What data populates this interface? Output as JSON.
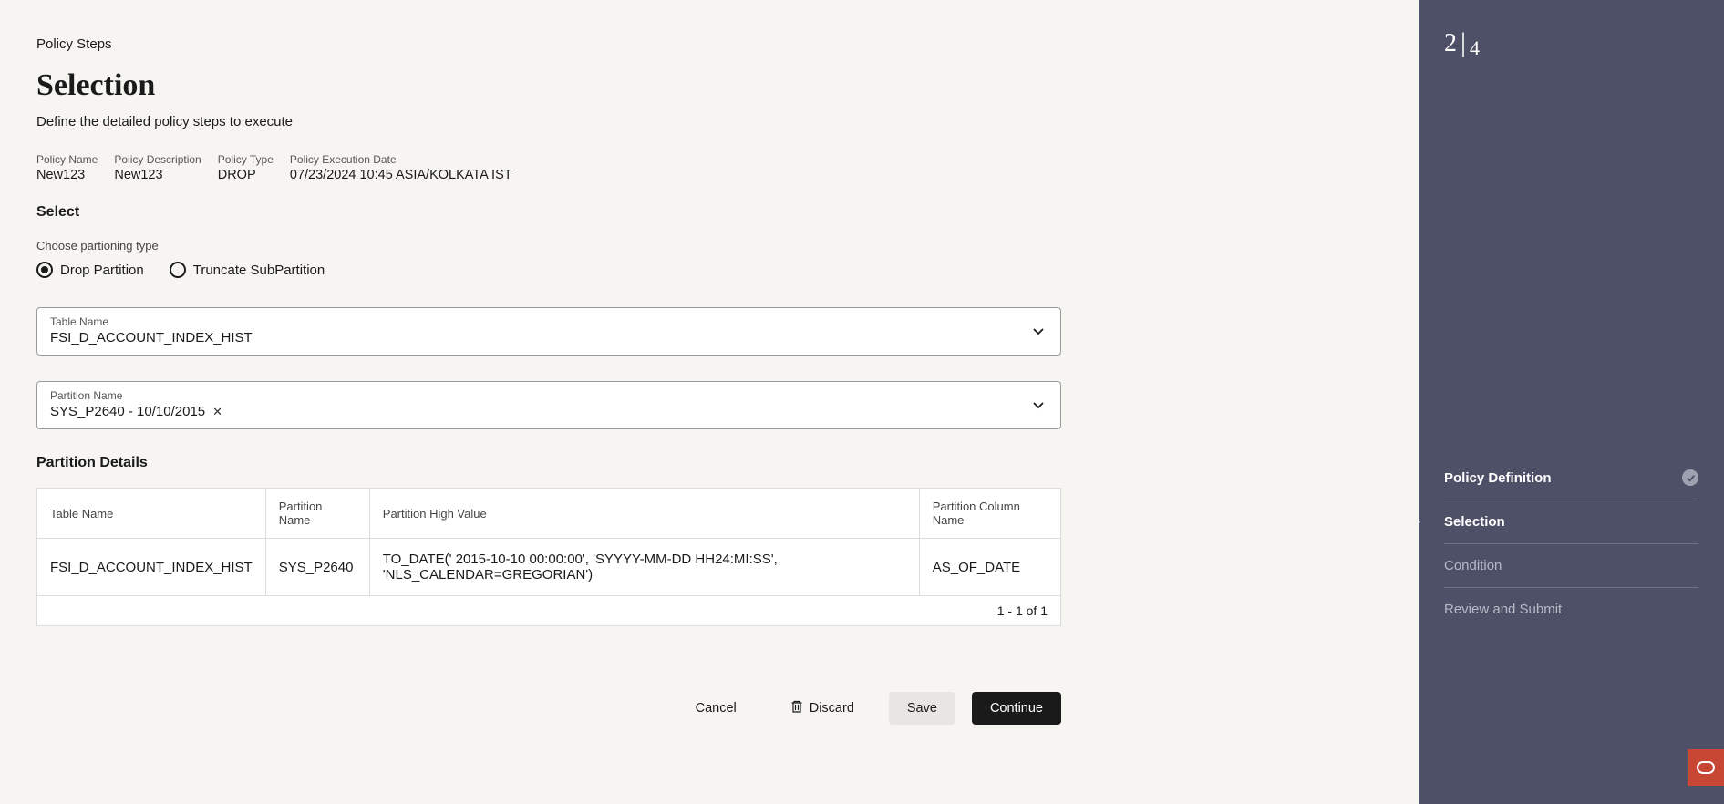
{
  "breadcrumb": "Policy Steps",
  "title": "Selection",
  "subtitle": "Define the detailed policy steps to execute",
  "meta": {
    "policy_name_label": "Policy Name",
    "policy_name_value": "New123",
    "policy_desc_label": "Policy Description",
    "policy_desc_value": "New123",
    "policy_type_label": "Policy Type",
    "policy_type_value": "DROP",
    "policy_exec_label": "Policy Execution Date",
    "policy_exec_value": "07/23/2024 10:45 ASIA/KOLKATA IST"
  },
  "select_section_header": "Select",
  "partitioning_label": "Choose partioning type",
  "radio": {
    "drop_label": "Drop Partition",
    "truncate_label": "Truncate SubPartition"
  },
  "table_name_field": {
    "label": "Table Name",
    "value": "FSI_D_ACCOUNT_INDEX_HIST"
  },
  "partition_name_field": {
    "label": "Partition Name",
    "value": "SYS_P2640 - 10/10/2015"
  },
  "details_header": "Partition Details",
  "details_columns": {
    "c0": "Table Name",
    "c1": "Partition Name",
    "c2": "Partition High Value",
    "c3": "Partition Column Name"
  },
  "details_row": {
    "c0": "FSI_D_ACCOUNT_INDEX_HIST",
    "c1": "SYS_P2640",
    "c2": "TO_DATE(' 2015-10-10 00:00:00', 'SYYYY-MM-DD HH24:MI:SS', 'NLS_CALENDAR=GREGORIAN')",
    "c3": "AS_OF_DATE"
  },
  "table_footer": "1 - 1 of 1",
  "actions": {
    "cancel": "Cancel",
    "discard": "Discard",
    "save": "Save",
    "continue": "Continue"
  },
  "wizard": {
    "current": "2",
    "total": "4",
    "steps": {
      "s0": "Policy Definition",
      "s1": "Selection",
      "s2": "Condition",
      "s3": "Review and Submit"
    }
  }
}
